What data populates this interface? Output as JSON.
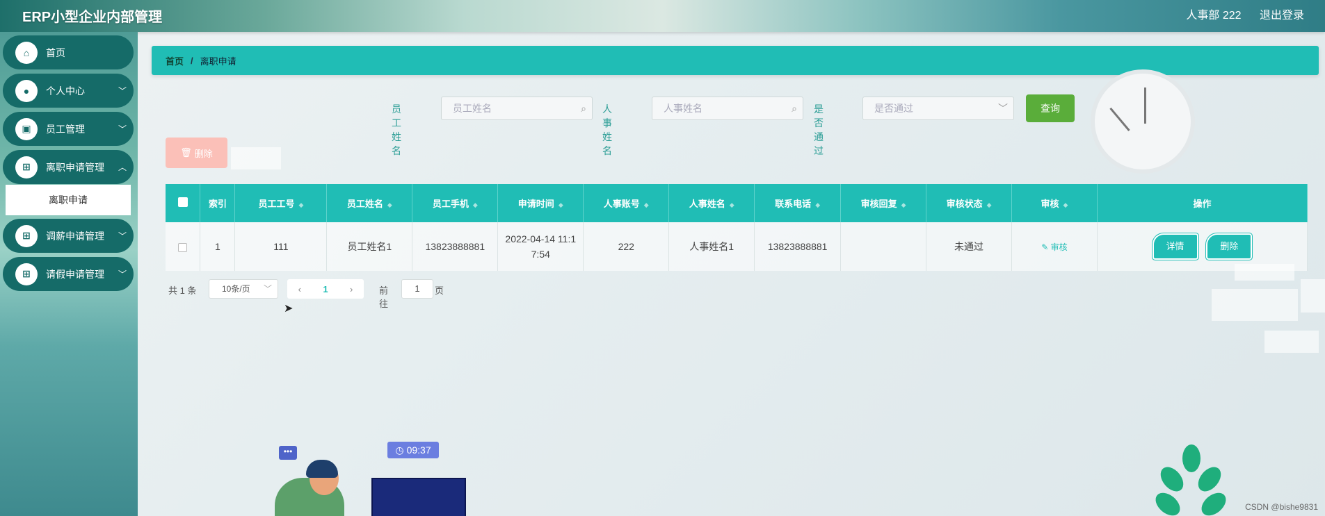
{
  "app": {
    "title": "ERP小型企业内部管理"
  },
  "header": {
    "user": "人事部 222",
    "logout": "退出登录"
  },
  "sidebar": {
    "items": [
      {
        "label": "首页",
        "icon": "home-icon",
        "glyph": "⌂",
        "has_chevron": false
      },
      {
        "label": "个人中心",
        "icon": "user-icon",
        "glyph": "●",
        "has_chevron": true
      },
      {
        "label": "员工管理",
        "icon": "briefcase-icon",
        "glyph": "▣",
        "has_chevron": true
      },
      {
        "label": "离职申请管理",
        "icon": "grid-icon",
        "glyph": "⊞",
        "has_chevron": true
      },
      {
        "label": "调薪申请管理",
        "icon": "grid-icon",
        "glyph": "⊞",
        "has_chevron": true
      },
      {
        "label": "请假申请管理",
        "icon": "grid-icon",
        "glyph": "⊞",
        "has_chevron": true
      }
    ],
    "submenu_active": "离职申请"
  },
  "breadcrumb": {
    "home": "首页",
    "separator": "/",
    "current": "离职申请"
  },
  "search": {
    "employee_name_label": "员工姓名",
    "employee_name_placeholder": "员工姓名",
    "hr_name_label": "人事姓名",
    "hr_name_placeholder": "人事姓名",
    "passed_label": "是否通过",
    "passed_placeholder": "是否通过",
    "query_button": "查询"
  },
  "toolbar": {
    "delete_label": "删除"
  },
  "table": {
    "headers": [
      "索引",
      "员工工号",
      "员工姓名",
      "员工手机",
      "申请时间",
      "人事账号",
      "人事姓名",
      "联系电话",
      "审核回复",
      "审核状态",
      "审核",
      "操作"
    ],
    "rows": [
      {
        "index": "1",
        "employee_no": "111",
        "employee_name": "员工姓名1",
        "employee_phone": "13823888881",
        "apply_time": "2022-04-14 11:17:54",
        "hr_account": "222",
        "hr_name": "人事姓名1",
        "contact_phone": "13823888881",
        "audit_reply": "",
        "audit_status": "未通过",
        "audit_link": "审核",
        "detail_button": "详情",
        "delete_button": "删除"
      }
    ]
  },
  "pagination": {
    "total": "共 1 条",
    "page_size": "10条/页",
    "current_page": "1",
    "goto_label": "前往",
    "goto_value": "1",
    "page_suffix": "页"
  },
  "decor": {
    "time": "09:37"
  },
  "watermark": "CSDN @bishe9831",
  "colors": {
    "primary": "#20bdb5",
    "sidebar_item": "#156b68",
    "query": "#5aad3a",
    "delete_disabled": "#fbc0b8"
  }
}
